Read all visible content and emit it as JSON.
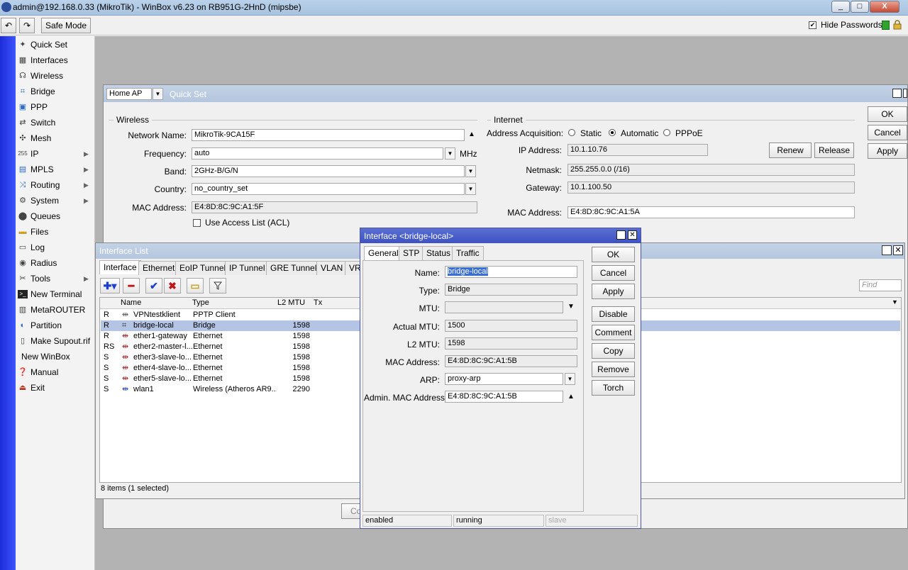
{
  "window": {
    "title": "admin@192.168.0.33 (MikroTik) - WinBox v6.23 on RB951G-2HnD (mipsbe)",
    "controls": [
      "_",
      "□",
      "X"
    ]
  },
  "toolbar": {
    "undo_icon": "undo-icon",
    "redo_icon": "redo-icon",
    "safe_mode_label": "Safe Mode",
    "hide_passwords_label": "Hide Passwords",
    "hide_passwords_checked": true
  },
  "sidebar": {
    "items": [
      {
        "label": "Quick Set",
        "icon": "wand-icon"
      },
      {
        "label": "Interfaces",
        "icon": "interfaces-icon"
      },
      {
        "label": "Wireless",
        "icon": "wireless-icon"
      },
      {
        "label": "Bridge",
        "icon": "bridge-icon"
      },
      {
        "label": "PPP",
        "icon": "ppp-icon"
      },
      {
        "label": "Switch",
        "icon": "switch-icon"
      },
      {
        "label": "Mesh",
        "icon": "mesh-icon"
      },
      {
        "label": "IP",
        "icon": "ip-icon",
        "submenu": true
      },
      {
        "label": "MPLS",
        "icon": "mpls-icon",
        "submenu": true
      },
      {
        "label": "Routing",
        "icon": "routing-icon",
        "submenu": true
      },
      {
        "label": "System",
        "icon": "system-icon",
        "submenu": true
      },
      {
        "label": "Queues",
        "icon": "queues-icon"
      },
      {
        "label": "Files",
        "icon": "files-icon"
      },
      {
        "label": "Log",
        "icon": "log-icon"
      },
      {
        "label": "Radius",
        "icon": "radius-icon"
      },
      {
        "label": "Tools",
        "icon": "tools-icon",
        "submenu": true
      },
      {
        "label": "New Terminal",
        "icon": "terminal-icon"
      },
      {
        "label": "MetaROUTER",
        "icon": "metarouter-icon"
      },
      {
        "label": "Partition",
        "icon": "partition-icon"
      },
      {
        "label": "Make Supout.rif",
        "icon": "supout-icon"
      },
      {
        "label": "New WinBox",
        "icon": ""
      },
      {
        "label": "Manual",
        "icon": "manual-icon"
      },
      {
        "label": "Exit",
        "icon": "exit-icon"
      }
    ]
  },
  "quickset": {
    "mode": "Home AP",
    "title": "Quick Set",
    "buttons": {
      "ok": "OK",
      "cancel": "Cancel",
      "apply": "Apply"
    },
    "wireless": {
      "section": "Wireless",
      "network_name_label": "Network Name:",
      "network_name": "MikroTik-9CA15F",
      "frequency_label": "Frequency:",
      "frequency": "auto",
      "frequency_unit": "MHz",
      "band_label": "Band:",
      "band": "2GHz-B/G/N",
      "country_label": "Country:",
      "country": "no_country_set",
      "mac_label": "MAC Address:",
      "mac": "E4:8D:8C:9C:A1:5F",
      "acl_label": "Use Access List (ACL)"
    },
    "internet": {
      "section": "Internet",
      "acq_label": "Address Acquisition:",
      "acq_static": "Static",
      "acq_automatic": "Automatic",
      "acq_pppoe": "PPPoE",
      "ip_label": "IP Address:",
      "ip": "10.1.10.76",
      "renew": "Renew",
      "release": "Release",
      "netmask_label": "Netmask:",
      "netmask": "255.255.0.0 (/16)",
      "gateway_label": "Gateway:",
      "gateway": "10.1.100.50",
      "mac_label": "MAC Address:",
      "mac": "E4:8D:8C:9C:A1:5A"
    }
  },
  "interface_list": {
    "title": "Interface List",
    "tabs": [
      "Interface",
      "Ethernet",
      "EoIP Tunnel",
      "IP Tunnel",
      "GRE Tunnel",
      "VLAN",
      "VR"
    ],
    "find_placeholder": "Find",
    "columns": [
      "Name",
      "Type",
      "L2 MTU",
      "Tx"
    ],
    "rows": [
      {
        "flag": "R",
        "name": "VPNtestklient",
        "type": "PPTP Client",
        "l2mtu": "",
        "icon": "pptp-icon"
      },
      {
        "flag": "R",
        "name": "bridge-local",
        "type": "Bridge",
        "l2mtu": "1598",
        "icon": "bridge-icon",
        "selected": true
      },
      {
        "flag": "R",
        "name": "ether1-gateway",
        "type": "Ethernet",
        "l2mtu": "1598",
        "icon": "ethernet-icon"
      },
      {
        "flag": "RS",
        "name": "ether2-master-l...",
        "type": "Ethernet",
        "l2mtu": "1598",
        "icon": "ethernet-icon"
      },
      {
        "flag": "S",
        "name": "ether3-slave-lo...",
        "type": "Ethernet",
        "l2mtu": "1598",
        "icon": "ethernet-icon"
      },
      {
        "flag": "S",
        "name": "ether4-slave-lo...",
        "type": "Ethernet",
        "l2mtu": "1598",
        "icon": "ethernet-icon"
      },
      {
        "flag": "S",
        "name": "ether5-slave-lo...",
        "type": "Ethernet",
        "l2mtu": "1598",
        "icon": "ethernet-icon"
      },
      {
        "flag": "S",
        "name": "wlan1",
        "type": "Wireless (Atheros AR9...",
        "l2mtu": "2290",
        "icon": "wireless-icon"
      }
    ],
    "status": "8 items (1 selected)"
  },
  "dialog": {
    "title": "Interface <bridge-local>",
    "tabs": [
      "General",
      "STP",
      "Status",
      "Traffic"
    ],
    "fields": {
      "name_label": "Name:",
      "name": "bridge-local",
      "type_label": "Type:",
      "type": "Bridge",
      "mtu_label": "MTU:",
      "mtu": "",
      "actual_mtu_label": "Actual MTU:",
      "actual_mtu": "1500",
      "l2mtu_label": "L2 MTU:",
      "l2mtu": "1598",
      "mac_label": "MAC Address:",
      "mac": "E4:8D:8C:9C:A1:5B",
      "arp_label": "ARP:",
      "arp": "proxy-arp",
      "admin_mac_label": "Admin. MAC Address:",
      "admin_mac": "E4:8D:8C:9C:A1:5B"
    },
    "buttons": [
      "OK",
      "Cancel",
      "Apply",
      "Disable",
      "Comment",
      "Copy",
      "Remove",
      "Torch"
    ],
    "status": [
      "enabled",
      "running",
      "slave"
    ]
  },
  "background_fragment": "Cop"
}
